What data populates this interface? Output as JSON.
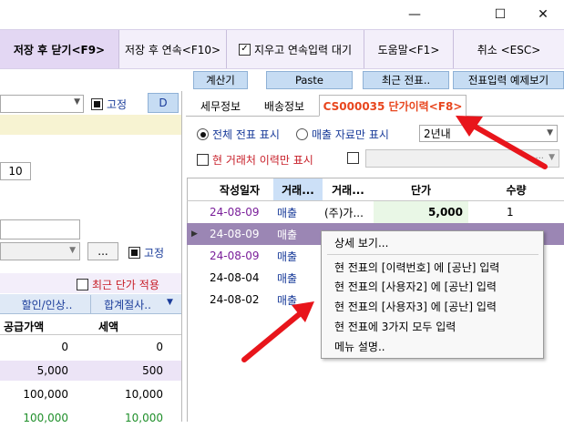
{
  "window": {
    "minimize": "—",
    "maximize": "☐",
    "close": "✕"
  },
  "toolbar": {
    "save_close": "저장 후 닫기<F9>",
    "save_continue": "저장 후 연속<F10>",
    "clear_continue": "지우고 연속입력 대기",
    "clear_continue_checked": true,
    "help": "도움말<F1>",
    "cancel": "취소 <ESC>"
  },
  "sub_toolbar": {
    "calculator": "계산기",
    "paste": "Paste",
    "recent_slip": "최근 전표..",
    "slip_preview": "전표입력 예제보기"
  },
  "left": {
    "fixed_label": "고정",
    "d_button": "D",
    "number_value": "10",
    "ellipsis": "...",
    "fixed_label2": "고정",
    "recent_price": "최근 단가 적용",
    "tabs": [
      "할인/인상..",
      "합계절사.."
    ],
    "columns": [
      "공급가액",
      "세액"
    ],
    "rows": [
      {
        "supply": "0",
        "tax": "0"
      },
      {
        "supply": "5,000",
        "tax": "500"
      },
      {
        "supply": "100,000",
        "tax": "10,000"
      },
      {
        "supply": "100,000",
        "tax": "10,000"
      }
    ]
  },
  "right": {
    "tabs": [
      "세무정보",
      "배송정보",
      "CS000035 단가이력<F8>"
    ],
    "radio_all": "전체 전표 표시",
    "radio_sales": "매출 자료만 표시",
    "period": "2년내",
    "current_client_only": "현 거래처 이력만 표시",
    "columns": [
      "작성일자",
      "거래...",
      "거래...",
      "단가",
      "수량"
    ],
    "rows": [
      {
        "date": "24-08-09",
        "type": "매출",
        "client": "(주)가...",
        "price": "5,000",
        "qty": "1"
      },
      {
        "date": "24-08-09",
        "type": "매출",
        "client": "",
        "price": "",
        "qty": ""
      },
      {
        "date": "24-08-09",
        "type": "매출",
        "client": "",
        "price": "",
        "qty": ""
      },
      {
        "date": "24-08-04",
        "type": "매출",
        "client": "",
        "price": "",
        "qty": ""
      },
      {
        "date": "24-08-02",
        "type": "매출",
        "client": "",
        "price": "",
        "qty": ""
      }
    ]
  },
  "context_menu": [
    "상세 보기...",
    "현 전표의 [이력번호] 에 [공난] 입력",
    "현 전표의 [사용자2] 에 [공난] 입력",
    "현 전표의 [사용자3] 에 [공난] 입력",
    "현 전표에 3가지 모두 입력",
    "메뉴 설명.."
  ],
  "colors": {
    "accent_red": "#e8461e",
    "selected_row": "#9b86b4",
    "arrow": "#e8151b",
    "button_blue": "#c6dcf3"
  }
}
